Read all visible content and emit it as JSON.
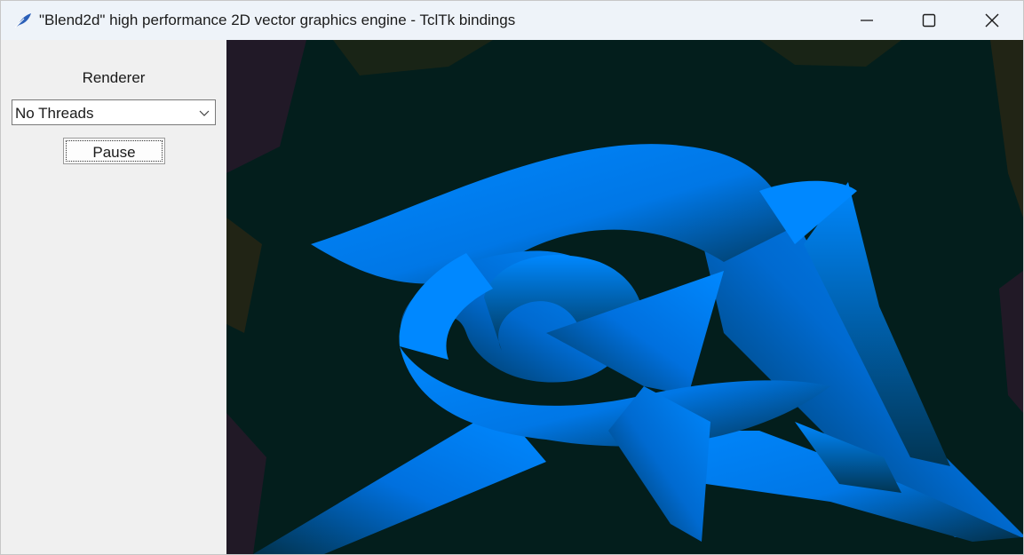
{
  "window": {
    "title": "\"Blend2d\" high performance 2D vector graphics engine - TclTk bindings",
    "app_icon": "feather-icon",
    "controls": [
      "minimize-icon",
      "maximize-icon",
      "close-icon"
    ]
  },
  "sidebar": {
    "renderer_label": "Renderer",
    "renderer_select": {
      "value": "No Threads",
      "icon": "chevron-down-icon"
    },
    "pause_label": "Pause"
  },
  "canvas": {
    "background_color": "#031e1c",
    "shape_color": "#0088ff"
  }
}
